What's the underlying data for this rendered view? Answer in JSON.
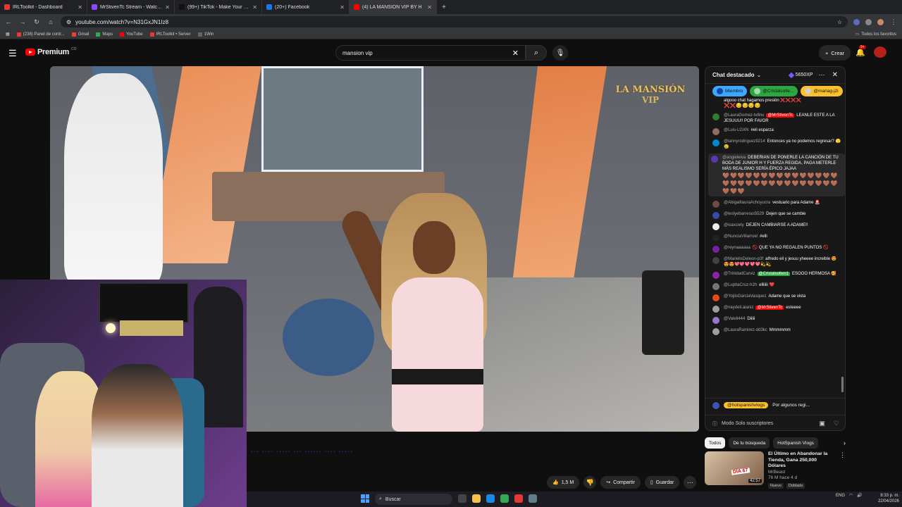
{
  "browser": {
    "tabs": [
      {
        "title": "IRLToolkit - Dashboard",
        "color": "#e53935",
        "active": false
      },
      {
        "title": "MrStivenTc Stream - Watch Live",
        "color": "#9146ff",
        "active": false
      },
      {
        "title": "(99+) TikTok - Make Your Day",
        "color": "#111111",
        "active": false
      },
      {
        "title": "(20+) Facebook",
        "color": "#1877f2",
        "active": false
      },
      {
        "title": "(4) LA MANSIÓN VIP BY H",
        "color": "#ff0000",
        "active": true
      }
    ],
    "url": "youtube.com/watch?v=N31GxJN1Iz8",
    "bookmarks": [
      {
        "label": "(238) Panel de contr...",
        "color": "#e53935"
      },
      {
        "label": "Gmail",
        "color": "#ea4335"
      },
      {
        "label": "Maps",
        "color": "#34a853"
      },
      {
        "label": "YouTube",
        "color": "#ff0000"
      },
      {
        "label": "IRLToolkit • Server",
        "color": "#e53935"
      },
      {
        "label": "1Win",
        "color": "#333333"
      }
    ],
    "bookmarks_right": "Todos los favoritos"
  },
  "youtube": {
    "logo": "Premium",
    "logo_sup": "CO",
    "search_value": "mansion vip",
    "create_label": "Crear",
    "notif_count": "9+"
  },
  "video": {
    "overlay_line1": "LA MANSIÓN",
    "overlay_line2": "VIP"
  },
  "actions": {
    "likes": "1,5 M",
    "share": "Compartir",
    "save": "Guardar"
  },
  "chat": {
    "title": "Chat destacado",
    "xp": "5650XP",
    "pinned": [
      {
        "label": "Miembro",
        "bg": "#3ea6ff"
      },
      {
        "label": "@Cristalsolte...",
        "bg": "#2ba640"
      },
      {
        "label": "@mariag-j2i",
        "bg": "#fbc02d"
      }
    ],
    "messages": [
      {
        "author": "",
        "text": "algooo chat hagamos presión ❌❌❌❌",
        "extra": "❌❌😔😔😔😔",
        "color": "#555"
      },
      {
        "author": "@LauraGomez-tv8nu",
        "mention": "@MrStivenTc",
        "text": "LEANLE ESTE A LA JESUUU!! POR FAVOR",
        "color": "#2e7d32"
      },
      {
        "author": "@Luis-LGXN",
        "text": "#eli esparza",
        "color": "#8d6e63"
      },
      {
        "author": "@iannyrodriguez9214",
        "text": "Entonces ya no podemos regresar? 🫣😢",
        "color": "#0288d1"
      },
      {
        "author": "@angieleiva",
        "text": "DEBERIAN DE PONERLE LA CANCIÓN DE TU BODA DE JUNIOR H Y FUERZA REGIDA, PAGA METERLE MÁS REALISMO SERÍA ÉPICO JAJAA",
        "hearts": "🤎🤎🤎🤎🤎🤎🤎🤎🤎🤎🤎🤎🤎🤎🤎🤎🤎🤎🤎🤎🤎🤎🤎🤎🤎🤎🤎🤎🤎🤎🤎🤎🤎",
        "color": "#5e35b1",
        "highlight": true
      },
      {
        "author": "@AbigailIauraAchoyucra",
        "text": "vestuario para Adame 🚨",
        "color": "#6d4c41"
      },
      {
        "author": "@leslyebarreras5529",
        "text": "Dejen que se cambie",
        "color": "#3949ab"
      },
      {
        "author": "@isaxcwty",
        "text": "DEJEN CAMBIARSE A ADAME!!",
        "color": "#eeeeee"
      },
      {
        "author": "@NunciaVillarroel",
        "text": "#elli",
        "color": "#212121"
      },
      {
        "author": "@reynaaaaaa",
        "text": "🚫 QUE YA NO REGALEN PUNTOS 🚫",
        "color": "#7b1fa2"
      },
      {
        "author": "@MarielisDeleon-p3f",
        "text": "alfredo eli y jesuu yheeee increible 😍😍😍💖💖💖💖💖💫💫",
        "color": "#424242"
      },
      {
        "author": "@TrinidadCarviz",
        "mention": "@Cristalsolten1",
        "mention_color": "green",
        "text": "ESOOO HERMOSA 🥰",
        "color": "#8e24aa"
      },
      {
        "author": "@LupitaCruz-h2h",
        "text": "elliiiii ❤️",
        "color": "#757575"
      },
      {
        "author": "@YojiisGarciaVasquez",
        "text": "Adame que se vista",
        "color": "#e64a19"
      },
      {
        "author": "@naydeli.alaniz",
        "mention": "@MrStivenTc",
        "text": "esteeee",
        "color": "#9e9e9e"
      },
      {
        "author": "@Valeli444",
        "text": "Diiiii",
        "color": "#9575cd"
      },
      {
        "author": "@LauraRamirez-dd3kc",
        "text": "Mmmmmm",
        "color": "#9e9e9e"
      }
    ],
    "ticker_user": "@hotspanishvlogs",
    "ticker_text": "Por algunos regi...",
    "mode": "Modo Solo suscriptores"
  },
  "filters": [
    "Todos",
    "De tu búsqueda",
    "HotSpanish Vlogs"
  ],
  "recommend": {
    "title": "El Último en Abandonar la Tienda, Gana 250,000 Dólares",
    "channel": "MrBeast",
    "meta": "76 M  hace 4 d",
    "badges": [
      "Nuevo",
      "Doblado"
    ],
    "duration": "42:57",
    "thumb_tag": "DÍA 67"
  },
  "taskbar": {
    "search": "Buscar",
    "lang": "ENG",
    "time": "8:33 p. m.",
    "date": "22/04/2026"
  }
}
